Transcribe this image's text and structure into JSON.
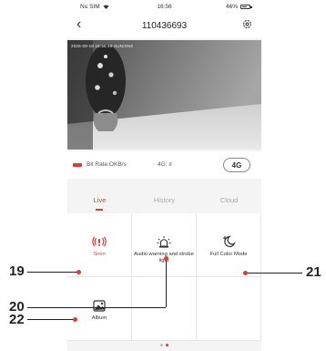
{
  "status_bar": {
    "carrier": "N≤ SIM",
    "time": "16:56",
    "battery": "46%"
  },
  "header": {
    "title": "110436693"
  },
  "video": {
    "overlay_text": "2025-09-18  16:56:49  SUN/SNS"
  },
  "info_bar": {
    "bitrate": "Bit Rate:OKB/s",
    "network": "4G: ıl",
    "network_button": "4G"
  },
  "tabs": [
    {
      "label": "Live",
      "active": true
    },
    {
      "label": "History",
      "active": false
    },
    {
      "label": "Cloud",
      "active": false
    }
  ],
  "functions": [
    {
      "label": "Siren",
      "icon": "siren-icon"
    },
    {
      "label": "Audio warning and strobe light",
      "icon": "alarm-light-icon"
    },
    {
      "label": "Full Color Mode",
      "icon": "moon-icon"
    },
    {
      "label": "Album",
      "icon": "image-icon"
    }
  ],
  "pagination": {
    "count": 2,
    "active_index": 1
  },
  "callouts": [
    {
      "number": "19",
      "target": "Siren"
    },
    {
      "number": "20",
      "target": "Audio warning and strobe light"
    },
    {
      "number": "21",
      "target": "Full Color Mode"
    },
    {
      "number": "22",
      "target": "Album"
    }
  ],
  "colors": {
    "accent": "#e53935",
    "background": "#f4f4f4"
  }
}
